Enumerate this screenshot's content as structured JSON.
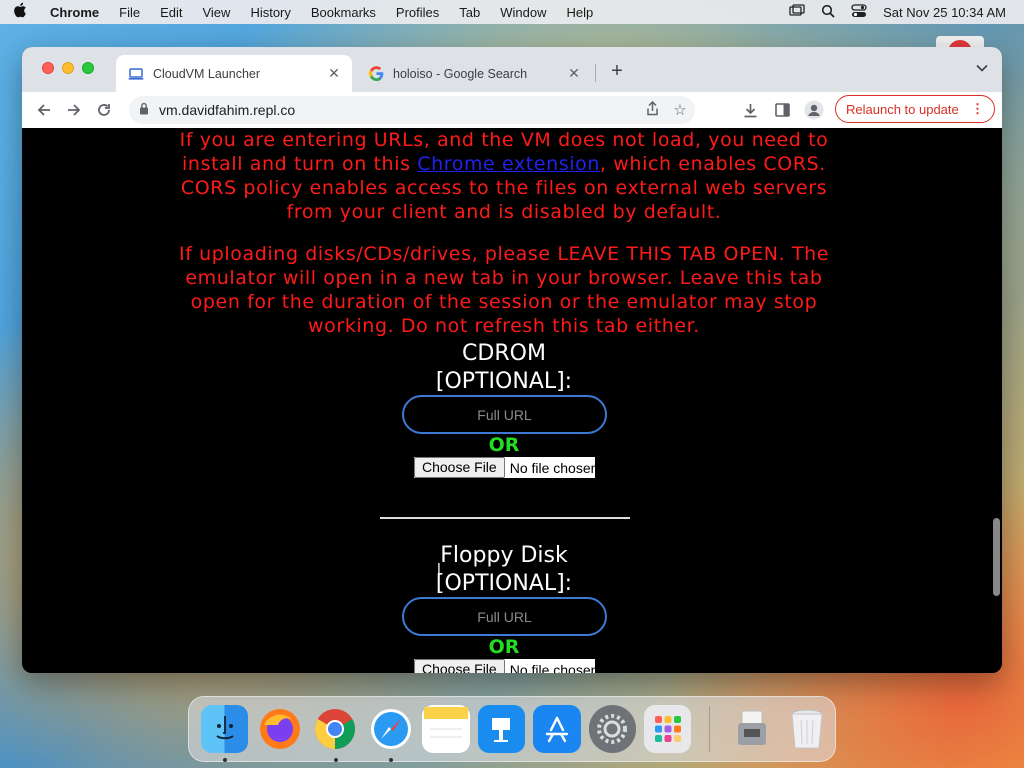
{
  "menubar": {
    "apple_icon": "apple-logo-icon",
    "items": [
      "Chrome",
      "File",
      "Edit",
      "View",
      "History",
      "Bookmarks",
      "Profiles",
      "Tab",
      "Window",
      "Help"
    ],
    "clock": "Sat Nov 25  10:34 AM",
    "status_icons": [
      "display-icon",
      "search-icon",
      "control-center-icon"
    ]
  },
  "browser": {
    "tabs": [
      {
        "title": "CloudVM Launcher",
        "favicon": "laptop-icon",
        "active": true
      },
      {
        "title": "holoiso - Google Search",
        "favicon": "google-g-icon",
        "active": false
      }
    ],
    "url": "vm.davidfahim.repl.co",
    "relaunch_label": "Relaunch to update"
  },
  "page": {
    "warning1_pre": "If you are entering URLs, and the VM does not load, you need to install and turn on this ",
    "warning1_link": "Chrome extension",
    "warning1_post": ", which enables CORS. CORS policy enables access to the files on external web servers from your client and is disabled by default.",
    "warning2": "If uploading disks/CDs/drives, please LEAVE THIS TAB OPEN. The emulator will open in a new tab in your browser. Leave this tab open for the duration of the session or the emulator may stop working. Do not refresh this tab either.",
    "cdrom": {
      "title": "CDROM [OPTIONAL]:",
      "placeholder": "Full URL",
      "or_label": "OR",
      "choose_label": "Choose File",
      "no_file_label": "No file chosen"
    },
    "floppy": {
      "title": "Floppy Disk [OPTIONAL]:",
      "placeholder": "Full URL",
      "or_label": "OR",
      "choose_label": "Choose File",
      "no_file_label": "No file chosen"
    }
  },
  "dock": {
    "apps": [
      {
        "name": "Finder",
        "icon": "finder-icon",
        "running": true
      },
      {
        "name": "Firefox",
        "icon": "firefox-icon",
        "running": false
      },
      {
        "name": "Google Chrome",
        "icon": "chrome-icon",
        "running": true
      },
      {
        "name": "Safari",
        "icon": "safari-icon",
        "running": true
      },
      {
        "name": "Notes",
        "icon": "notes-icon",
        "running": false
      },
      {
        "name": "Keynote",
        "icon": "keynote-icon",
        "running": false
      },
      {
        "name": "App Store",
        "icon": "app-store-icon",
        "running": false
      },
      {
        "name": "System Settings",
        "icon": "settings-icon",
        "running": false
      },
      {
        "name": "Launchpad",
        "icon": "launchpad-icon",
        "running": false
      }
    ],
    "others": [
      {
        "name": "Downloads",
        "icon": "downloads-stack-icon"
      },
      {
        "name": "Trash",
        "icon": "trash-icon"
      }
    ]
  }
}
